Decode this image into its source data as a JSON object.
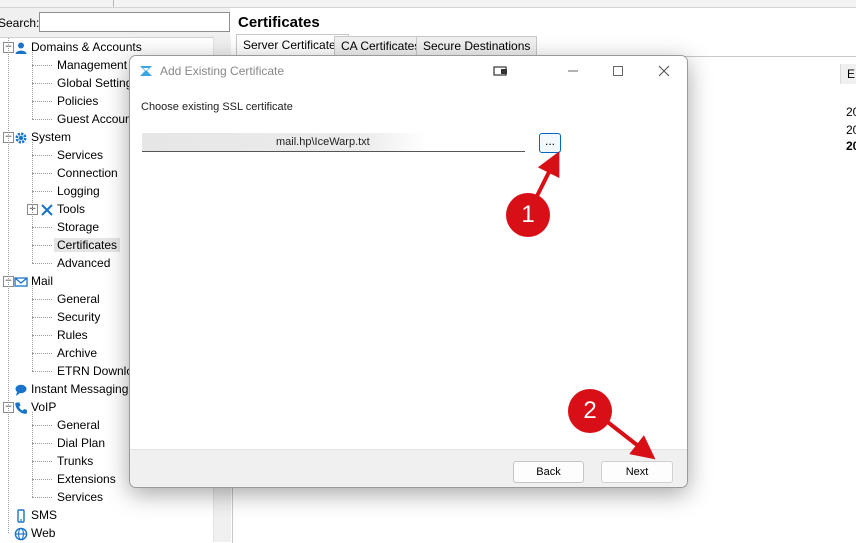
{
  "search": {
    "label": "Search:",
    "value": ""
  },
  "content": {
    "title": "Certificates",
    "tabs": [
      {
        "label": "Server Certificates",
        "active": true
      },
      {
        "label": "CA Certificates",
        "active": false
      },
      {
        "label": "Secure Destinations",
        "active": false
      }
    ],
    "column_header_peek": "E",
    "right_peek_values": [
      "20",
      "20",
      "20"
    ]
  },
  "tree": [
    {
      "label": "Domains & Accounts",
      "level": 0,
      "icon": "user-icon",
      "expander": "minus"
    },
    {
      "label": "Management",
      "level": 1
    },
    {
      "label": "Global Settings",
      "level": 1
    },
    {
      "label": "Policies",
      "level": 1
    },
    {
      "label": "Guest Accounts",
      "level": 1
    },
    {
      "label": "System",
      "level": 0,
      "icon": "gear-icon",
      "expander": "minus"
    },
    {
      "label": "Services",
      "level": 1
    },
    {
      "label": "Connection",
      "level": 1
    },
    {
      "label": "Logging",
      "level": 1
    },
    {
      "label": "Tools",
      "level": 1,
      "icon": "tools-icon",
      "expander": "plus"
    },
    {
      "label": "Storage",
      "level": 1
    },
    {
      "label": "Certificates",
      "level": 1,
      "selected": true
    },
    {
      "label": "Advanced",
      "level": 1
    },
    {
      "label": "Mail",
      "level": 0,
      "icon": "mail-icon",
      "expander": "minus"
    },
    {
      "label": "General",
      "level": 1
    },
    {
      "label": "Security",
      "level": 1
    },
    {
      "label": "Rules",
      "level": 1
    },
    {
      "label": "Archive",
      "level": 1
    },
    {
      "label": "ETRN Downloader",
      "level": 1
    },
    {
      "label": "Instant Messaging",
      "level": 0,
      "icon": "chat-icon"
    },
    {
      "label": "VoIP",
      "level": 0,
      "icon": "phone-icon",
      "expander": "minus"
    },
    {
      "label": "General",
      "level": 1
    },
    {
      "label": "Dial Plan",
      "level": 1
    },
    {
      "label": "Trunks",
      "level": 1
    },
    {
      "label": "Extensions",
      "level": 1
    },
    {
      "label": "Services",
      "level": 1
    },
    {
      "label": "SMS",
      "level": 0,
      "icon": "sms-icon"
    },
    {
      "label": "Web",
      "level": 0,
      "icon": "globe-icon"
    }
  ],
  "dialog": {
    "title": "Add Existing Certificate",
    "prompt": "Choose existing SSL certificate",
    "path_value": "mail.hp\\IceWarp.txt",
    "browse_label": "...",
    "back_label": "Back",
    "next_label": "Next"
  },
  "annotations": [
    {
      "label": "1"
    },
    {
      "label": "2"
    }
  ],
  "colors": {
    "annotation": "#d80f16",
    "accent": "#0067c0",
    "tree_blue": "#1a73c8"
  }
}
